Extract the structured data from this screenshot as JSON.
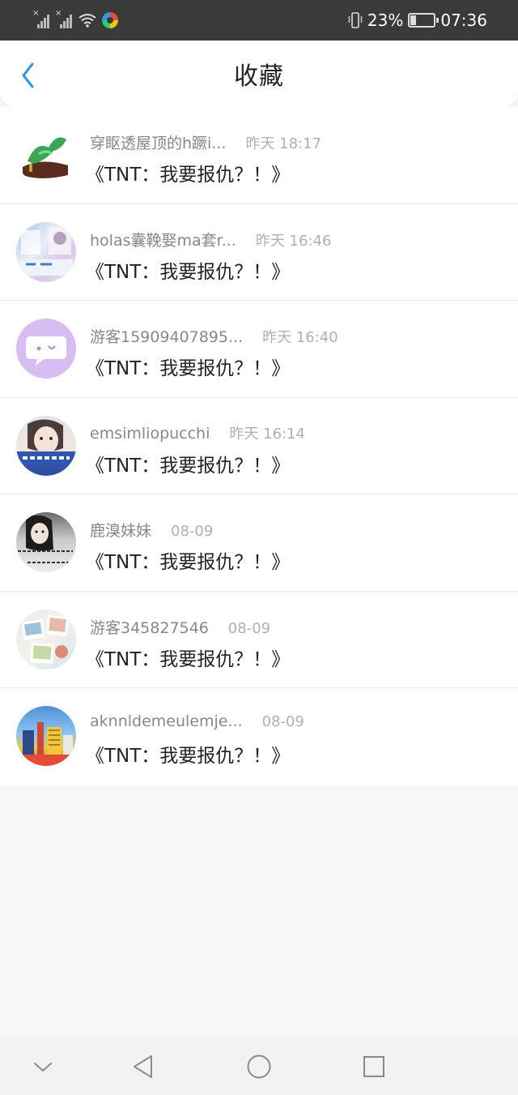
{
  "status_bar": {
    "battery_percent": "23%",
    "battery_level": 0.23,
    "time": "07:36"
  },
  "header": {
    "title": "收藏",
    "accent_color": "#2196f3"
  },
  "items": [
    {
      "name": "穿眍透屋顶的h蹶i...",
      "time": "昨天 18:17",
      "content": "《TNT：我要报仇？！》",
      "avatar": "jade-dragon-avatar"
    },
    {
      "name": "holas囊鞔娶ma套r...",
      "time": "昨天 16:46",
      "content": "《TNT：我要报仇？！》",
      "avatar": "photo-collage-avatar"
    },
    {
      "name": "游客15909407895...",
      "time": "昨天 16:40",
      "content": "《TNT：我要报仇？！》",
      "avatar": "chat-bubble-avatar"
    },
    {
      "name": "emsimliopucchi",
      "time": "昨天 16:14",
      "content": "《TNT：我要报仇？！》",
      "avatar": "girl-photo-avatar"
    },
    {
      "name": "鹿溴妹妹",
      "time": "08-09",
      "content": "《TNT：我要报仇？！》",
      "avatar": "girl-portrait-avatar"
    },
    {
      "name": "游客345827546",
      "time": "08-09",
      "content": "《TNT：我要报仇？！》",
      "avatar": "polaroid-avatar"
    },
    {
      "name": "aknnldemeulemje...",
      "time": "08-09",
      "content": "《TNT：我要报仇？！》",
      "avatar": "city-photo-avatar"
    }
  ]
}
